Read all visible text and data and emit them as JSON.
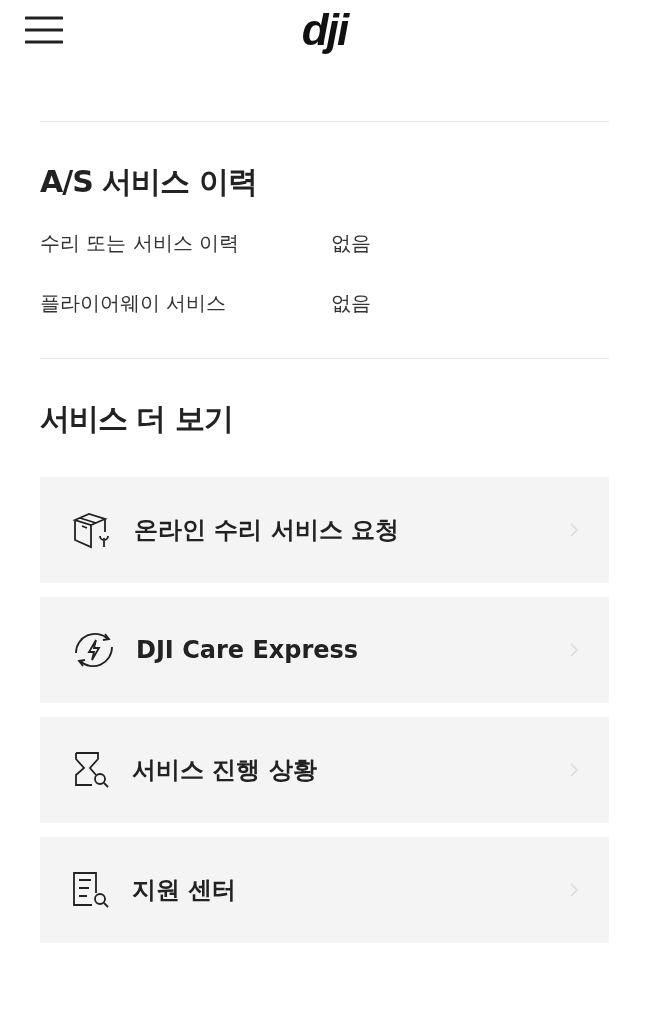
{
  "header": {
    "logo": "dji"
  },
  "history": {
    "title": "A/S 서비스 이력",
    "rows": [
      {
        "label": "수리 또는 서비스 이력",
        "value": "없음"
      },
      {
        "label": "플라이어웨이 서비스",
        "value": "없음"
      }
    ]
  },
  "more": {
    "title": "서비스 더 보기",
    "items": [
      {
        "kind": "repair",
        "label": "온라인 수리 서비스 요청"
      },
      {
        "kind": "care",
        "label": "DJI Care Express"
      },
      {
        "kind": "progress",
        "label": "서비스 진행 상황"
      },
      {
        "kind": "support",
        "label": "지원 센터"
      }
    ]
  }
}
